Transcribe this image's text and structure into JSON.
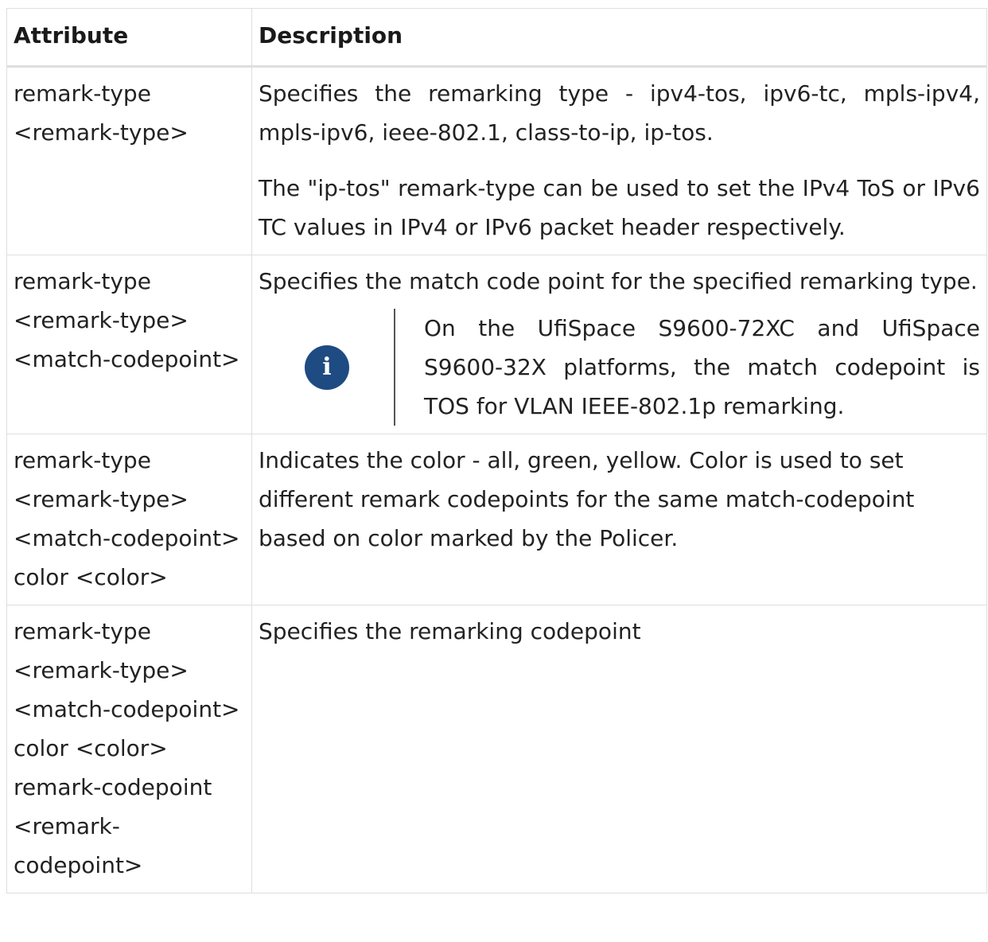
{
  "table": {
    "headers": [
      "Attribute",
      "Description"
    ],
    "rows": [
      {
        "attribute": "remark-type <remark-type>",
        "description": [
          "Specifies the remarking type - ipv4-tos, ipv6-tc, mpls-ipv4, mpls-ipv6, ieee-802.1, class-to-ip, ip-tos.",
          "The \"ip-tos\" remark-type can be used to set the IPv4 ToS or IPv6 TC values in IPv4 or IPv6 packet header respectively."
        ]
      },
      {
        "attribute": "remark-type <remark-type> <match-codepoint>",
        "description": [
          "Specifies the match code point for the specified remarking type."
        ],
        "note": {
          "icon": "info-icon",
          "icon_glyph": "i",
          "icon_color": "#1e4b82",
          "text": "On the UfiSpace S9600-72XC and UfiSpace S9600-32X platforms, the match codepoint is TOS for VLAN IEEE-802.1p remarking."
        }
      },
      {
        "attribute": "remark-type <remark-type> <match-codepoint> color <color>",
        "description": [
          "Indicates the color - all, green, yellow. Color is used to set different remark codepoints for the same match-codepoint based on color marked by the Policer."
        ]
      },
      {
        "attribute": "remark-type <remark-type> <match-codepoint> color <color> remark-codepoint <remark-codepoint>",
        "description": [
          "Specifies the remarking codepoint"
        ]
      }
    ]
  }
}
